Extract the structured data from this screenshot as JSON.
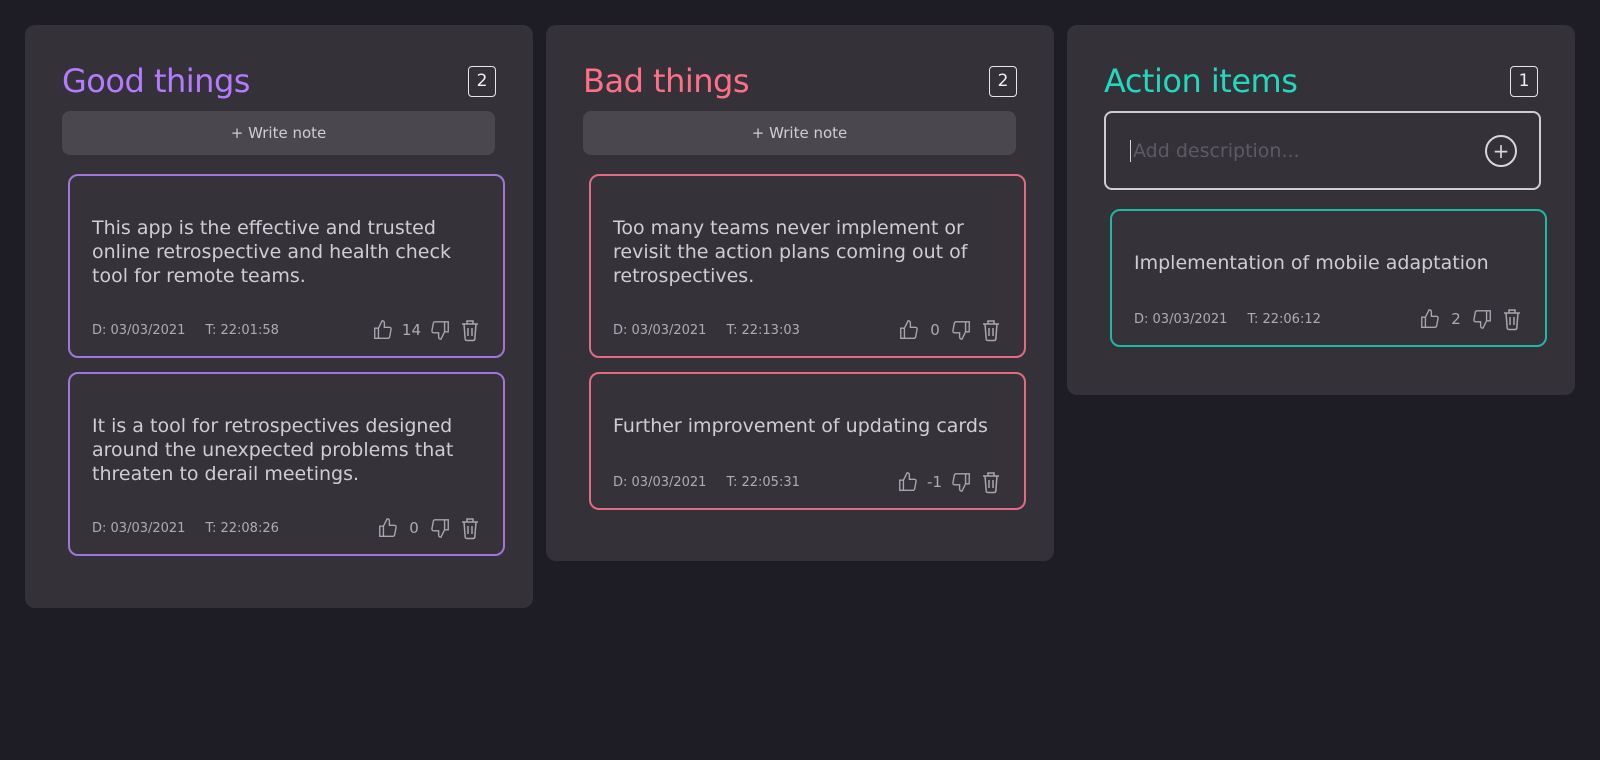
{
  "colors": {
    "good": "#b57bff",
    "bad": "#ff7088",
    "action": "#22d8bf"
  },
  "good": {
    "title": "Good things",
    "count": "2",
    "write_label": "+ Write note",
    "notes": [
      {
        "text": "This app is the effective and trusted online retrospective and health check tool for remote teams.",
        "date": "D: 03/03/2021",
        "time": "T: 22:01:58",
        "likes": "14"
      },
      {
        "text": "It is a tool for retrospectives designed around the unexpected problems that threaten to derail meetings.",
        "date": "D: 03/03/2021",
        "time": "T: 22:08:26",
        "likes": "0"
      }
    ]
  },
  "bad": {
    "title": "Bad things",
    "count": "2",
    "write_label": "+ Write note",
    "notes": [
      {
        "text": "Too many teams never implement or revisit the action plans coming out of retrospectives.",
        "date": "D: 03/03/2021",
        "time": "T: 22:13:03",
        "likes": "0"
      },
      {
        "text": "Further improvement of updating cards",
        "date": "D: 03/03/2021",
        "time": "T: 22:05:31",
        "likes": "-1"
      }
    ]
  },
  "action": {
    "title": "Action items",
    "count": "1",
    "add_placeholder": "Add description...",
    "notes": [
      {
        "text": "Implementation of mobile adaptation",
        "date": "D: 03/03/2021",
        "time": "T: 22:06:12",
        "likes": "2"
      }
    ]
  }
}
